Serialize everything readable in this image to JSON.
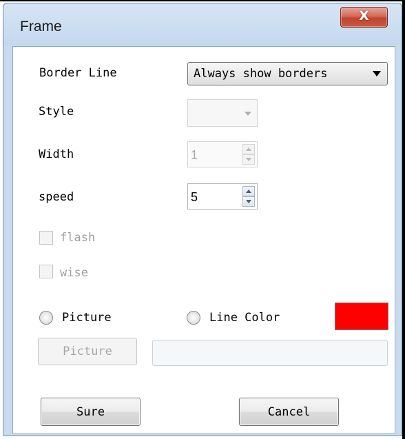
{
  "window": {
    "title": "Frame",
    "close_glyph": "X"
  },
  "form": {
    "border_line": {
      "label": "Border Line",
      "selected": "Always show borders"
    },
    "style": {
      "label": "Style",
      "selected": "",
      "disabled": true
    },
    "width": {
      "label": "Width",
      "value": "1",
      "disabled": true
    },
    "speed": {
      "label": "speed",
      "value": "5"
    },
    "flash": {
      "label": "flash",
      "checked": false,
      "disabled": true
    },
    "wise": {
      "label": "wise",
      "checked": false,
      "disabled": true
    },
    "picture_radio": {
      "label": "Picture",
      "checked": false
    },
    "line_color_radio": {
      "label": "Line Color",
      "checked": false
    },
    "line_color": "#ff0000",
    "picture_button": {
      "label": "Picture",
      "disabled": true
    },
    "picture_path": {
      "value": "",
      "disabled": true
    }
  },
  "buttons": {
    "sure": "Sure",
    "cancel": "Cancel"
  }
}
